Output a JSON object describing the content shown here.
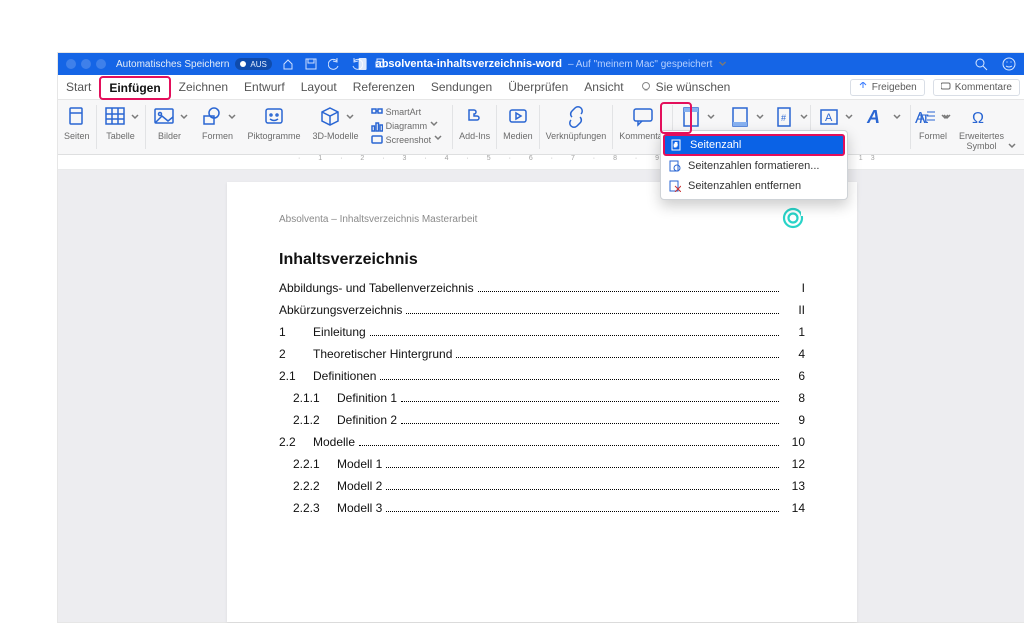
{
  "titlebar": {
    "autosave_label": "Automatisches Speichern",
    "autosave_state": "AUS",
    "filename": "absolventa-inhaltsverzeichnis-word",
    "saved_text": "– Auf \"meinem Mac\" gespeichert"
  },
  "tabs": {
    "items": [
      "Start",
      "Einfügen",
      "Zeichnen",
      "Entwurf",
      "Layout",
      "Referenzen",
      "Sendungen",
      "Überprüfen",
      "Ansicht"
    ],
    "wish": "Sie wünschen",
    "share": "Freigeben",
    "comments": "Kommentare"
  },
  "ribbon": {
    "seiten": "Seiten",
    "tabelle": "Tabelle",
    "bilder": "Bilder",
    "formen": "Formen",
    "pikto": "Piktogramme",
    "model3d": "3D-Modelle",
    "smartart": "SmartArt",
    "diagramm": "Diagramm",
    "screenshot": "Screenshot",
    "addins": "Add-Ins",
    "medien": "Medien",
    "links": "Verknüpfungen",
    "kommentar": "Kommentar",
    "kopfzeile": "Kopfzeile",
    "fusszeile": "Fußzeile",
    "formel": "Formel",
    "symbol": "Erweitertes\nSymbol"
  },
  "menu": {
    "i1": "Seitenzahl",
    "i2": "Seitenzahlen formatieren...",
    "i3": "Seitenzahlen entfernen"
  },
  "doc": {
    "header": "Absolventa – Inhaltsverzeichnis Masterarbeit",
    "h1": "Inhaltsverzeichnis",
    "rows": [
      {
        "n": "",
        "t": "Abbildungs- und Tabellenverzeichnis",
        "p": "I",
        "lvl": 0
      },
      {
        "n": "",
        "t": "Abkürzungsverzeichnis",
        "p": "II",
        "lvl": 0
      },
      {
        "n": "1",
        "t": "Einleitung",
        "p": "1",
        "lvl": 1
      },
      {
        "n": "2",
        "t": "Theoretischer Hintergrund",
        "p": "4",
        "lvl": 1
      },
      {
        "n": "2.1",
        "t": "Definitionen",
        "p": "6",
        "lvl": 1
      },
      {
        "n": "2.1.1",
        "t": "Definition 1",
        "p": "8",
        "lvl": 2
      },
      {
        "n": "2.1.2",
        "t": "Definition 2",
        "p": "9",
        "lvl": 2
      },
      {
        "n": "2.2",
        "t": "Modelle",
        "p": "10",
        "lvl": 1
      },
      {
        "n": "2.2.1",
        "t": "Modell 1",
        "p": "12",
        "lvl": 2
      },
      {
        "n": "2.2.2",
        "t": "Modell 2",
        "p": "13",
        "lvl": 2
      },
      {
        "n": "2.2.3",
        "t": "Modell 3",
        "p": "14",
        "lvl": 2
      }
    ]
  }
}
